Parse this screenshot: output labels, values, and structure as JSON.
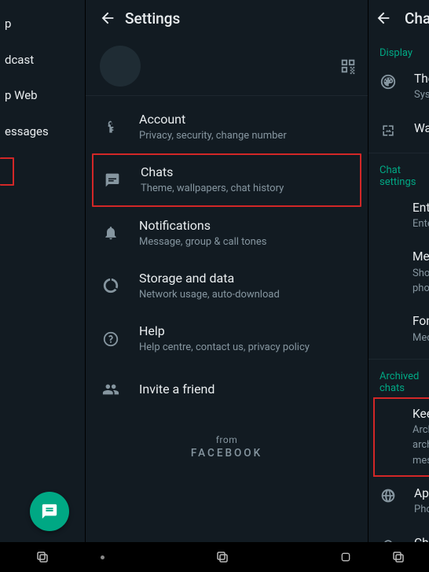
{
  "screenA": {
    "menu": {
      "group": {
        "label": "p"
      },
      "broadcast": {
        "label": "dcast"
      },
      "web": {
        "label": "p Web"
      },
      "starred": {
        "label": "essages"
      }
    }
  },
  "screenB": {
    "appbar": {
      "title": "Settings"
    },
    "rows": {
      "account": {
        "title": "Account",
        "subtitle": "Privacy, security, change number"
      },
      "chats": {
        "title": "Chats",
        "subtitle": "Theme, wallpapers, chat history"
      },
      "notifications": {
        "title": "Notifications",
        "subtitle": "Message, group & call tones"
      },
      "storage": {
        "title": "Storage and data",
        "subtitle": "Network usage, auto-download"
      },
      "help": {
        "title": "Help",
        "subtitle": "Help centre, contact us, privacy policy"
      },
      "invite": {
        "title": "Invite a friend"
      }
    },
    "footer": {
      "from": "from",
      "brand": "FACEBOOK"
    }
  },
  "screenC": {
    "appbar": {
      "title": "Chat"
    },
    "sections": {
      "display": "Display",
      "chat_settings": "Chat settings",
      "archived": "Archived chats"
    },
    "rows": {
      "theme": {
        "title": "Them",
        "subtitle": "System"
      },
      "wallpaper": {
        "title": "Wallp"
      },
      "enter": {
        "title": "Enter",
        "subtitle": "Enter k"
      },
      "media": {
        "title": "Media",
        "subtitle1": "Show n",
        "subtitle2": "phone'"
      },
      "font": {
        "title": "Font s",
        "subtitle": "Mediur"
      },
      "keep": {
        "title": "Keep c",
        "subtitle1": "Archive",
        "subtitle2": "archive",
        "subtitle3": "messa"
      },
      "applang": {
        "title": "App L",
        "subtitle": "Phone'"
      },
      "chatb": {
        "title": "Chat b"
      }
    }
  }
}
